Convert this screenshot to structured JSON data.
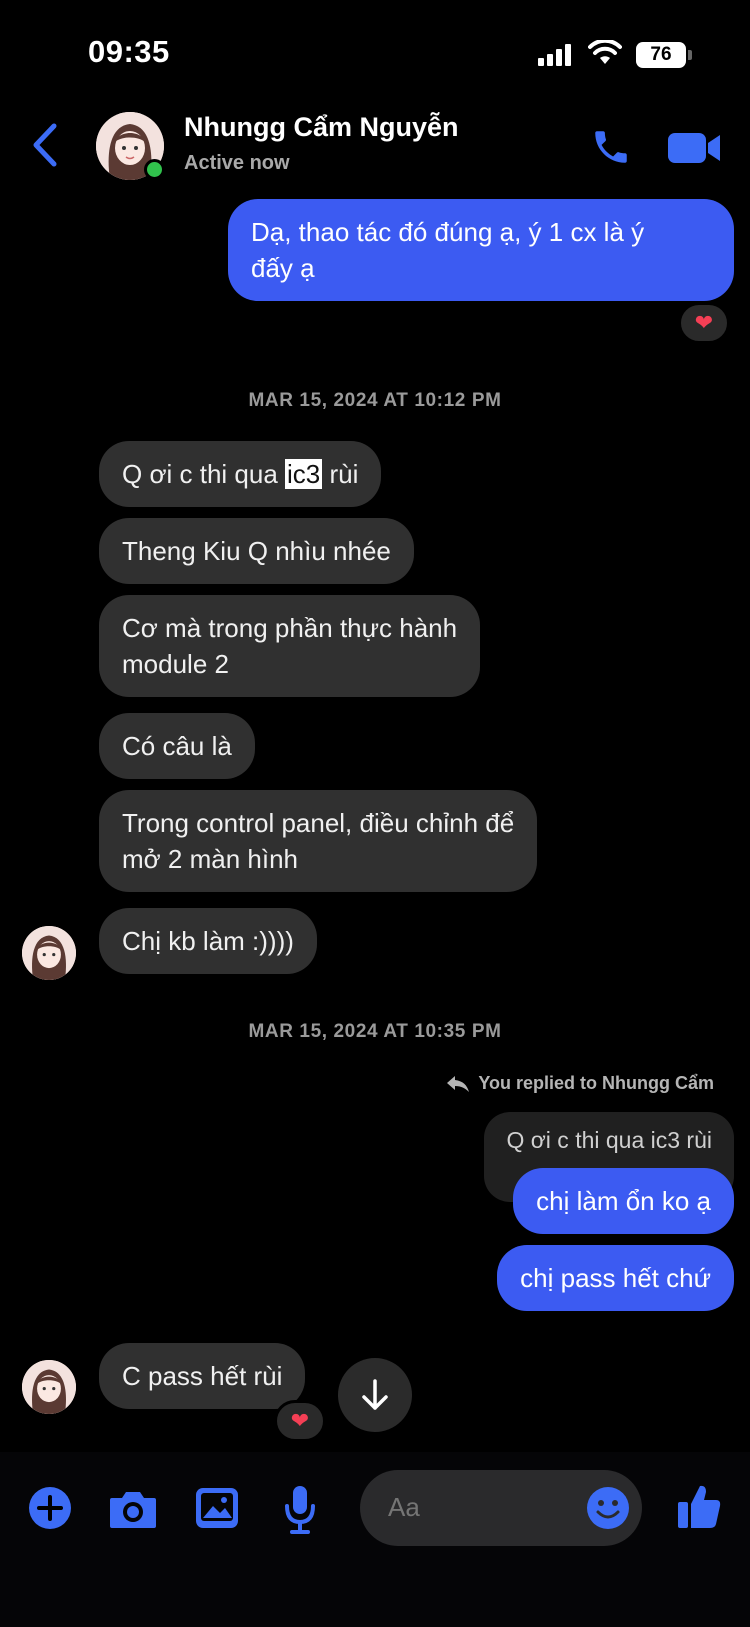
{
  "status_bar": {
    "time": "09:35",
    "battery": "76"
  },
  "header": {
    "name": "Nhungg Cẩm Nguyễn",
    "status": "Active now"
  },
  "messages": {
    "m1_line1": "Dạ, thao tác đó đúng ạ, ý 1 cx là ý",
    "m1_line2": "đấy ạ",
    "ts1": "MAR 15, 2024 AT 10:12 PM",
    "m2_pre": "Q ơi c thi qua ",
    "m2_hl": "ic3",
    "m2_post": " rùi",
    "m3": "Theng Kiu Q nhìu nhée",
    "m4_line1": "Cơ mà trong phần thực hành",
    "m4_line2": "module 2",
    "m5": "Có câu là",
    "m6_line1": "Trong control panel, điều chỉnh để",
    "m6_line2": "mở 2 màn hình",
    "m7": "Chị kb làm :))))",
    "ts2": "MAR 15, 2024 AT 10:35 PM",
    "reply_meta": "You replied to Nhungg Cẩm",
    "reply_quote": "Q ơi c thi qua ic3 rùi",
    "m8": "chị làm ổn ko ạ",
    "m9": "chị pass hết chứ",
    "m10": "C pass hết rùi"
  },
  "reactions": {
    "heart": "❤"
  },
  "composer": {
    "placeholder": "Aa"
  },
  "colors": {
    "accent": "#3c5bf2",
    "incoming": "#303030",
    "background": "#000000"
  },
  "icons": [
    "back-arrow-icon",
    "phone-icon",
    "video-icon",
    "plus-icon",
    "camera-icon",
    "image-icon",
    "microphone-icon",
    "emoji-icon",
    "thumbs-up-icon",
    "arrow-down-icon",
    "reply-arrow-icon"
  ]
}
